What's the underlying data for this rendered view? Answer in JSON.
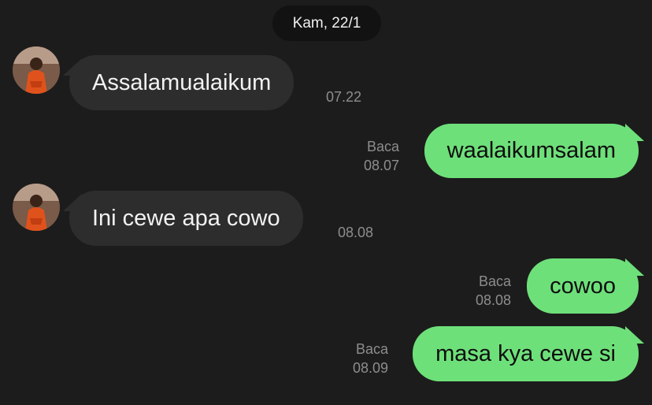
{
  "date_separator": "Kam, 22/1",
  "messages": [
    {
      "direction": "in",
      "text": "Assalamualaikum",
      "time": "07.22"
    },
    {
      "direction": "out",
      "text": "waalaikumsalam",
      "status": "Baca",
      "time": "08.07"
    },
    {
      "direction": "in",
      "text": "Ini cewe apa cowo",
      "time": "08.08"
    },
    {
      "direction": "out",
      "text": "cowoo",
      "status": "Baca",
      "time": "08.08"
    },
    {
      "direction": "out",
      "text": "masa kya cewe si",
      "status": "Baca",
      "time": "08.09"
    }
  ],
  "colors": {
    "background": "#1c1c1c",
    "incoming_bubble": "#2d2d2d",
    "outgoing_bubble": "#6ee07a",
    "meta_text": "#8d8d8d"
  }
}
